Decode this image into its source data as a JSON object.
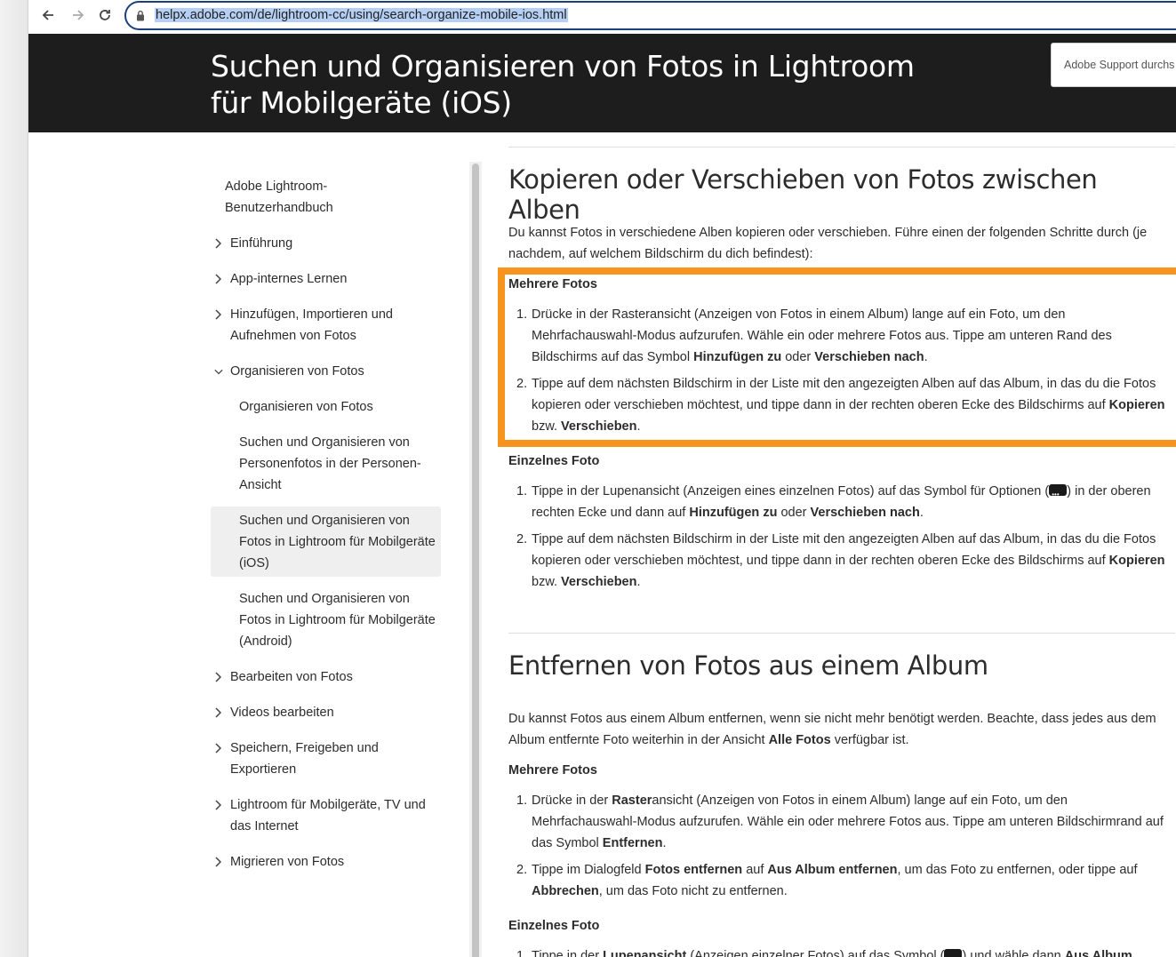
{
  "browser": {
    "url": "helpx.adobe.com/de/lightroom-cc/using/search-organize-mobile-ios.html"
  },
  "header": {
    "title": "Suchen und Organisieren von Fotos in Lightroom für Mobilgeräte (iOS)",
    "search_placeholder": "Adobe Support durchs"
  },
  "sidebar": {
    "root_line1": "Adobe Lightroom-",
    "root_line2": "Benutzerhandbuch",
    "items": [
      {
        "label": "Einführung"
      },
      {
        "label": "App-internes Lernen"
      },
      {
        "label": "Hinzufügen, Importieren und Aufnehmen von Fotos"
      },
      {
        "label": "Organisieren von Fotos"
      },
      {
        "label": "Bearbeiten von Fotos"
      },
      {
        "label": "Videos bearbeiten"
      },
      {
        "label": "Speichern, Freigeben und Exportieren"
      },
      {
        "label": "Lightroom für Mobilgeräte, TV und das Internet"
      },
      {
        "label": "Migrieren von Fotos"
      }
    ],
    "sub_items": [
      {
        "label": "Organisieren von Fotos"
      },
      {
        "label": "Suchen und Organisieren von Personenfotos in der Personen-Ansicht"
      },
      {
        "label": "Suchen und Organisieren von Fotos in Lightroom für Mobilgeräte (iOS)"
      },
      {
        "label": "Suchen und Organisieren von Fotos in Lightroom für Mobilgeräte (Android)"
      }
    ]
  },
  "section1": {
    "heading": "Kopieren oder Verschieben von Fotos zwischen Alben",
    "intro": "Du kannst Fotos in verschiedene Alben kopieren oder verschieben. Führe einen der folgenden Schritte durch (je nachdem, auf welchem Bildschirm du dich befindest):",
    "multi_title": "Mehrere Fotos",
    "single_title": "Einzelnes Foto"
  },
  "section2": {
    "heading": "Entfernen von Fotos aus einem Album",
    "multi_title": "Mehrere Fotos",
    "single_title": "Einzelnes Foto"
  }
}
